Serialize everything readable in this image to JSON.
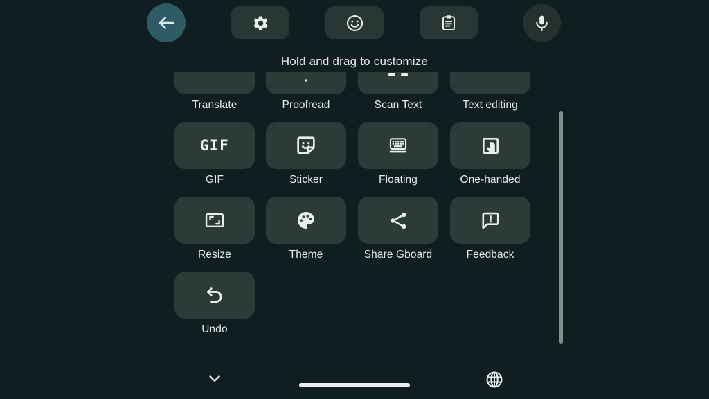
{
  "window": {
    "title": "Gboard toolbar customization",
    "background_color": "#101d21",
    "tile_color": "#2c3a38",
    "accent_color": "#2f5b66",
    "label_color": "#e6ecec"
  },
  "toolbar": {
    "back_button": {
      "label": "Back",
      "icon": "arrow-left-icon"
    },
    "chips": [
      {
        "name": "settings",
        "label": "Settings",
        "icon": "gear-icon"
      },
      {
        "name": "emoji",
        "label": "Emoji",
        "icon": "smiley-icon"
      },
      {
        "name": "clipboard",
        "label": "Clipboard",
        "icon": "clipboard-icon"
      }
    ],
    "mic_button": {
      "label": "Voice input",
      "icon": "microphone-icon"
    }
  },
  "hint": {
    "text": "Hold and drag to customize"
  },
  "grid": {
    "columns": 4,
    "rows": [
      {
        "clipped": true,
        "items": [
          {
            "label": "Translate",
            "icon": "translate-icon"
          },
          {
            "label": "Proofread",
            "icon": "proofread-icon"
          },
          {
            "label": "Scan Text",
            "icon": "scan-text-icon"
          },
          {
            "label": "Text editing",
            "icon": "text-editing-icon"
          }
        ]
      },
      {
        "clipped": false,
        "items": [
          {
            "label": "GIF",
            "icon": "gif-icon"
          },
          {
            "label": "Sticker",
            "icon": "sticker-icon"
          },
          {
            "label": "Floating",
            "icon": "floating-keyboard-icon"
          },
          {
            "label": "One-handed",
            "icon": "one-handed-icon"
          }
        ]
      },
      {
        "clipped": false,
        "items": [
          {
            "label": "Resize",
            "icon": "resize-icon"
          },
          {
            "label": "Theme",
            "icon": "palette-icon"
          },
          {
            "label": "Share Gboard",
            "icon": "share-icon"
          },
          {
            "label": "Feedback",
            "icon": "feedback-icon"
          }
        ]
      },
      {
        "clipped": false,
        "items": [
          {
            "label": "Undo",
            "icon": "undo-icon"
          }
        ]
      }
    ]
  },
  "scrollbar": {
    "orientation": "vertical",
    "thumb_color": "#7d908e"
  },
  "bottom_bar": {
    "collapse_button": {
      "label": "Collapse keyboard",
      "icon": "chevron-down-icon"
    },
    "language_button": {
      "label": "Change language",
      "icon": "globe-icon"
    },
    "home_indicator": {
      "label": "Home gesture bar"
    }
  }
}
